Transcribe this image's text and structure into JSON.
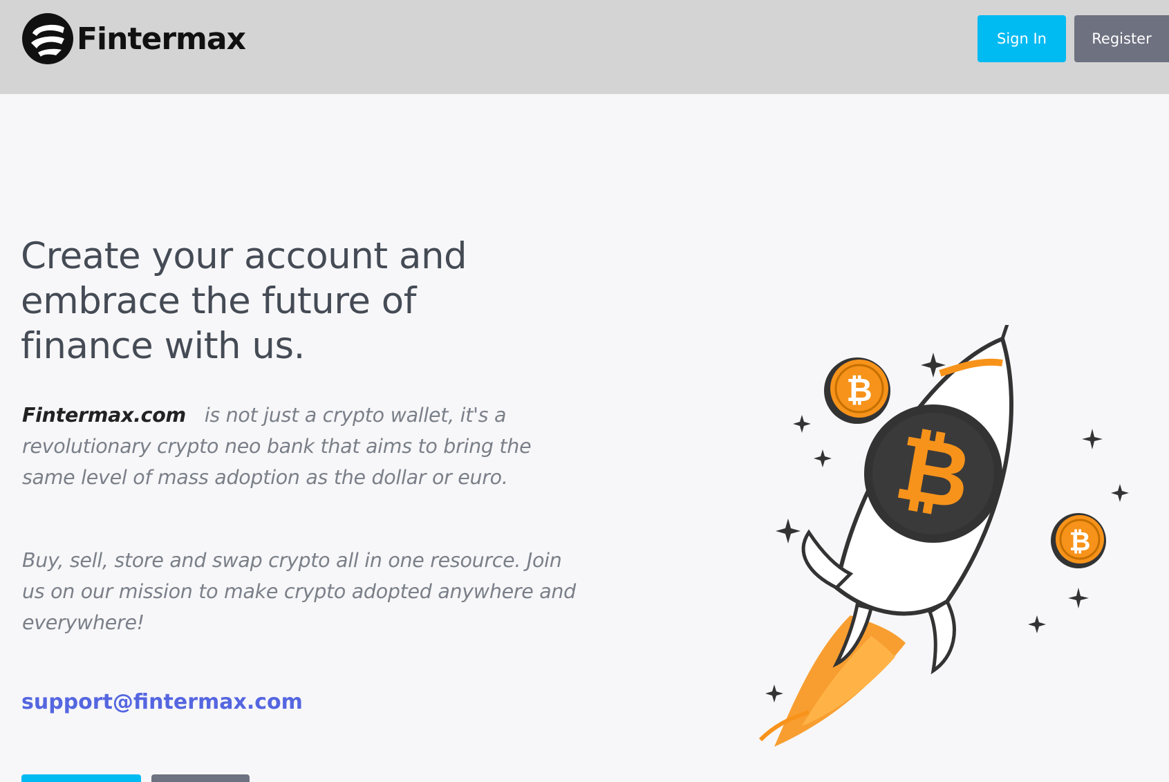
{
  "header": {
    "brand": "Fintermax",
    "signin_label": "Sign In",
    "register_label": "Register"
  },
  "hero": {
    "title": "Create your account and embrace the future of finance with us.",
    "para1_brand": "Fintermax.com",
    "para1_text": "is not just a crypto wallet, it's a revolutionary crypto neo bank that aims to bring the same level of mass adoption as the dollar or euro.",
    "para2": "Buy, sell, store and swap crypto all in one resource. Join us on our mission to make crypto adopted anywhere and everywhere!",
    "email": "support@fintermax.com"
  },
  "illustration": {
    "subject": "rocket-with-bitcoin-icon",
    "colors": {
      "orange": "#f7931a",
      "dark": "#3a3a3a"
    }
  },
  "colors": {
    "header_bg": "#d4d4d4",
    "page_bg": "#f7f7f9",
    "primary": "#00baf2",
    "secondary": "#6e7180",
    "link": "#5566e0"
  }
}
